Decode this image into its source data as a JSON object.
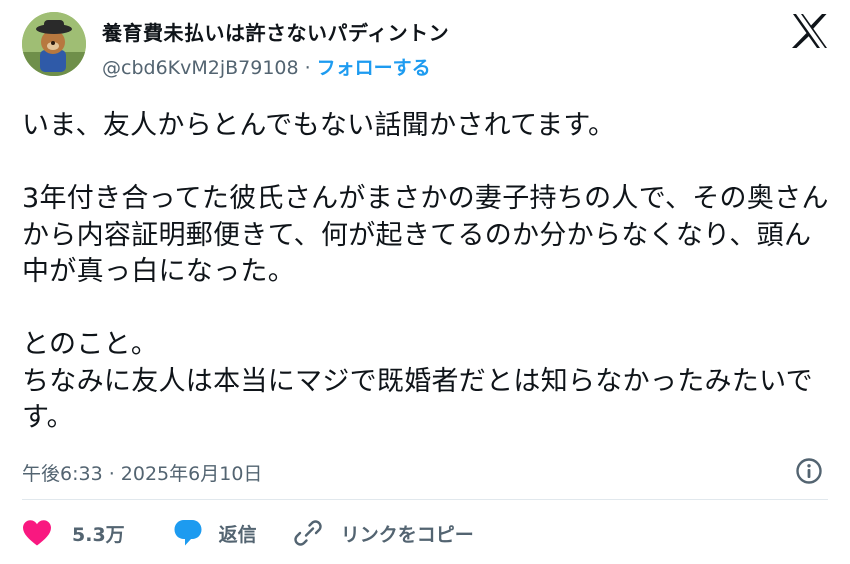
{
  "author": {
    "display_name": "養育費未払いは許さないパディントン",
    "handle": "@cbd6KvM2jB79108",
    "separator": "·",
    "follow_label": "フォローする"
  },
  "post": {
    "text": "いま、友人からとんでもない話聞かされてます。\n\n3年付き合ってた彼氏さんがまさかの妻子持ちの人で、その奥さんから内容証明郵便きて、何が起きてるのか分からなくなり、頭ん中が真っ白になった。\n\nとのこと。\nちなみに友人は本当にマジで既婚者だとは知らなかったみたいです。",
    "timestamp": "午後6:33 · 2025年6月10日"
  },
  "actions": {
    "like_count": "5.3万",
    "reply_label": "返信",
    "copy_link_label": "リンクをコピー"
  },
  "colors": {
    "accent": "#1d9bf0",
    "like": "#f91880",
    "muted": "#536471",
    "text": "#0f1419"
  },
  "icons": [
    "x-logo-icon",
    "info-icon",
    "heart-icon",
    "reply-bubble-icon",
    "link-icon"
  ]
}
